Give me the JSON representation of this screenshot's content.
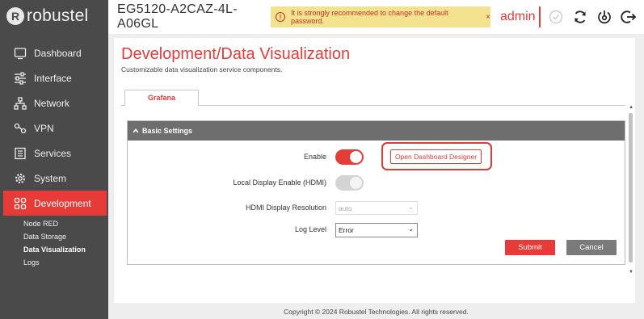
{
  "brand": {
    "logo_text": "robustel",
    "logo_mark": "R"
  },
  "sidebar": {
    "items": [
      {
        "label": "Dashboard",
        "icon": "dashboard-icon"
      },
      {
        "label": "Interface",
        "icon": "sliders-icon"
      },
      {
        "label": "Network",
        "icon": "network-icon"
      },
      {
        "label": "VPN",
        "icon": "vpn-icon"
      },
      {
        "label": "Services",
        "icon": "services-icon"
      },
      {
        "label": "System",
        "icon": "gear-icon"
      },
      {
        "label": "Development",
        "icon": "development-icon"
      }
    ],
    "subitems": [
      {
        "label": "Node RED"
      },
      {
        "label": "Data Storage"
      },
      {
        "label": "Data Visualization"
      },
      {
        "label": "Logs"
      }
    ]
  },
  "header": {
    "device_name": "EG5120-A2CAZ-4L-A06GL",
    "warning_icon": "!",
    "warning_text": "It is strongly recommended to change the default password.",
    "warning_close": "×",
    "user": "admin"
  },
  "page": {
    "title": "Development/Data Visualization",
    "subtitle": "Customizable data visualization service components.",
    "tab": "Grafana"
  },
  "section": {
    "title": "Basic Settings",
    "enable_label": "Enable",
    "designer_button": "Open Dashboard Designer",
    "hdmi_label": "Local Display Enable (HDMI)",
    "resolution_label": "HDMI Display Resolution",
    "resolution_value": "auto",
    "loglevel_label": "Log Level",
    "loglevel_value": "Error",
    "submit": "Submit",
    "cancel": "Cancel"
  },
  "footer": {
    "copyright": "Copyright © 2024 Robustel Technologies. All rights reserved."
  },
  "colors": {
    "accent": "#e63b36",
    "sidebar": "#4a4a4a",
    "warning_bg": "#f3e38f"
  }
}
